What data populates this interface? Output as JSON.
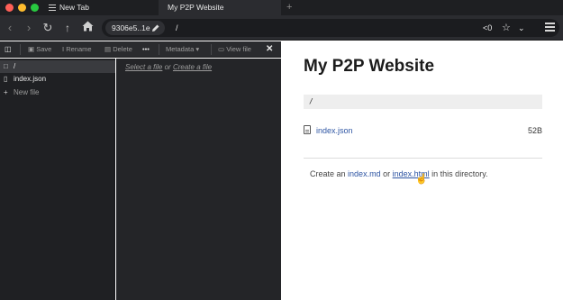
{
  "tabs": [
    {
      "label": "New Tab",
      "icon": "list-icon",
      "active": false
    },
    {
      "label": "My P2P Website",
      "active": true
    }
  ],
  "new_tab_glyph": "+",
  "navbar": {
    "site_key": "9306e5..1e",
    "path": "/",
    "share_count": "0",
    "icons": [
      "back-icon",
      "forward-icon",
      "reload-icon",
      "up-icon",
      "home-icon",
      "pencil-icon",
      "share-icon",
      "star-icon",
      "chevron-down-icon",
      "menu-icon"
    ]
  },
  "file_toolbar": {
    "save": "Save",
    "rename": "Rename",
    "delete": "Delete",
    "more": "•••",
    "metadata": "Metadata",
    "view_file": "View file",
    "close": "✕"
  },
  "file_tree": {
    "root": "/",
    "files": [
      "index.json"
    ],
    "new_file": "New file"
  },
  "preview": {
    "select_file": "Select a file",
    "or": "or",
    "create_file": "Create a file"
  },
  "page": {
    "title": "My P2P Website",
    "path": "/",
    "entries": [
      {
        "name": "index.json",
        "size": "52B"
      }
    ],
    "create_prefix": "Create an",
    "create_md": "index.md",
    "create_or": "or",
    "create_html": "index.html",
    "create_suffix": "in this directory."
  },
  "colors": {
    "chrome_dark": "#2b2c30",
    "link_blue": "#2e55a3",
    "traffic_red": "#fe5f57",
    "traffic_yellow": "#febc2e",
    "traffic_green": "#28c840"
  }
}
